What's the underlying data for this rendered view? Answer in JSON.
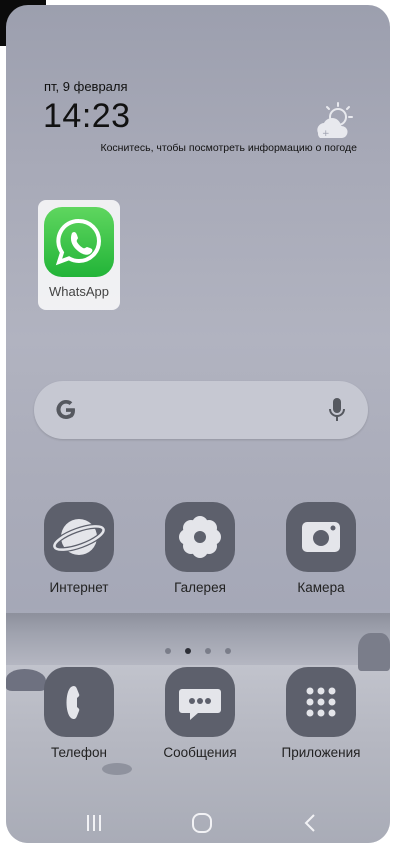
{
  "status": {
    "date": "пт, 9 февраля",
    "time": "14:23",
    "weather_hint": "Коснитесь, чтобы посмотреть информацию о погоде"
  },
  "home_apps": [
    {
      "label": "WhatsApp",
      "icon": "whatsapp-icon"
    }
  ],
  "search": {
    "engine_icon": "google-g-icon",
    "voice_icon": "microphone-icon"
  },
  "apps_row": [
    {
      "label": "Интернет",
      "icon": "internet-icon"
    },
    {
      "label": "Галерея",
      "icon": "gallery-icon"
    },
    {
      "label": "Камера",
      "icon": "camera-icon"
    }
  ],
  "pager": {
    "pages": 4,
    "active": 2
  },
  "dock": [
    {
      "label": "Телефон",
      "icon": "phone-icon"
    },
    {
      "label": "Сообщения",
      "icon": "messages-icon"
    },
    {
      "label": "Приложения",
      "icon": "apps-grid-icon"
    }
  ],
  "nav": {
    "recents_icon": "recents-icon",
    "home_icon": "home-icon",
    "back_icon": "back-icon"
  },
  "colors": {
    "whatsapp_green": "#25D366",
    "icon_bg": "#5d606c"
  }
}
